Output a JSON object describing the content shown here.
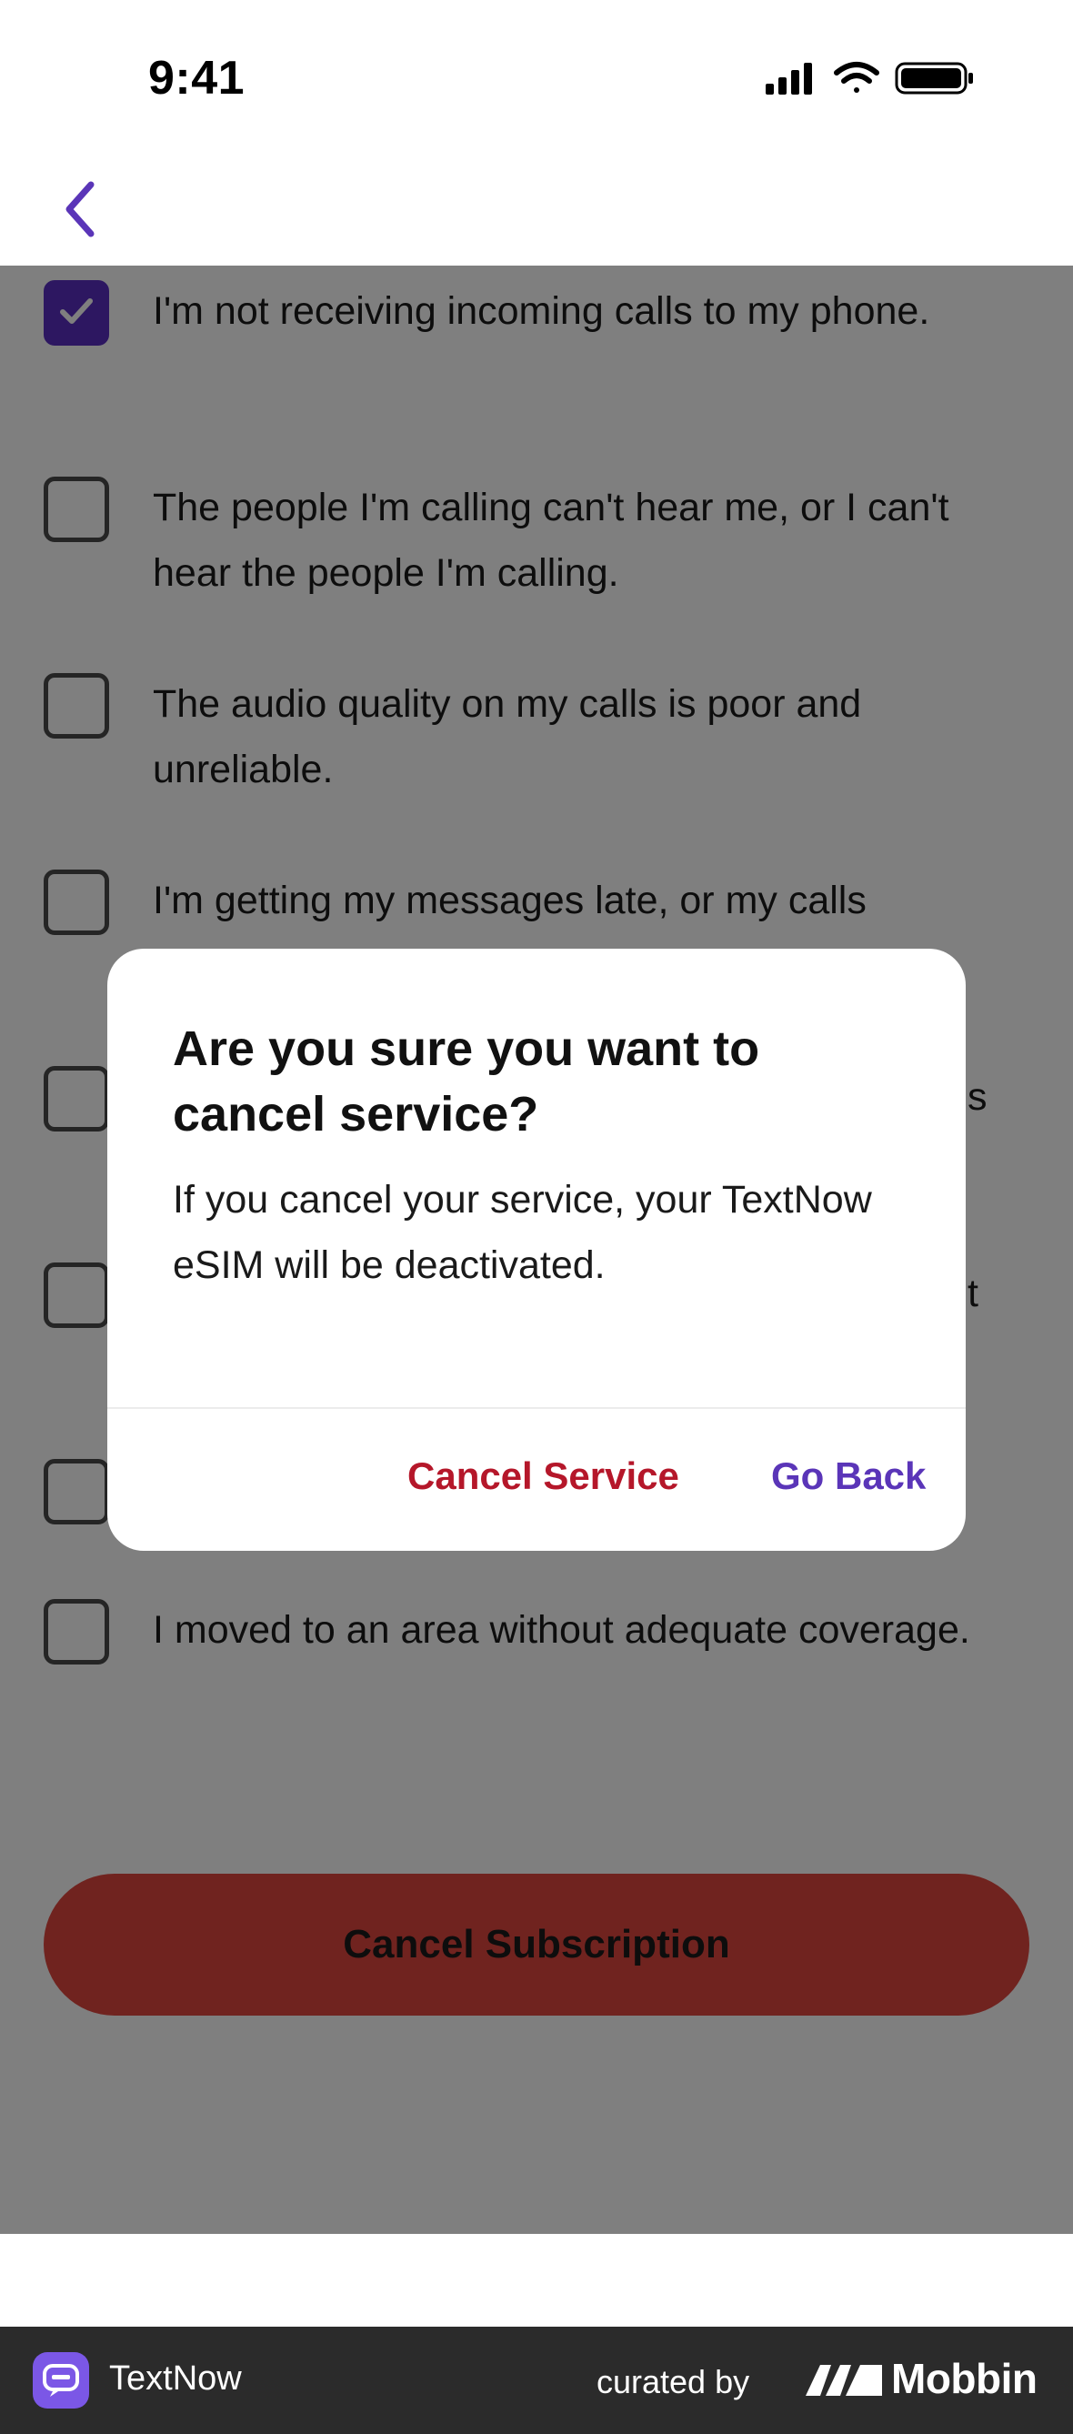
{
  "status_bar": {
    "time": "9:41",
    "icons": [
      "cellular-signal-icon",
      "wifi-icon",
      "battery-icon"
    ]
  },
  "nav": {
    "back_icon": "chevron-left-icon",
    "accent_color": "#5a35b8"
  },
  "reasons": [
    {
      "text": "I'm not receiving incoming calls to my phone.",
      "checked": true
    },
    {
      "text": "The people I'm calling can't hear me, or I can't hear the people I'm calling.",
      "checked": false
    },
    {
      "text": "The audio quality on my calls is poor and unreliable.",
      "checked": false
    },
    {
      "text": "I'm getting my messages late, or my calls",
      "checked": false
    },
    {
      "text": "s",
      "checked": false
    },
    {
      "text": "t",
      "checked": false
    },
    {
      "text": "",
      "checked": false
    },
    {
      "text": "I moved to an area without adequate coverage.",
      "checked": false
    }
  ],
  "primary_action": {
    "label": "Cancel Subscription",
    "color": "#e0463e"
  },
  "dialog": {
    "title": "Are you sure you want to cancel service?",
    "body": "If you cancel your service, your TextNow eSIM will be deactivated.",
    "confirm_label": "Cancel Service",
    "confirm_color": "#b5172a",
    "dismiss_label": "Go Back",
    "dismiss_color": "#5a35b8"
  },
  "footer": {
    "app_name": "TextNow",
    "curated_label": "curated by",
    "brand": "Mobbin"
  }
}
